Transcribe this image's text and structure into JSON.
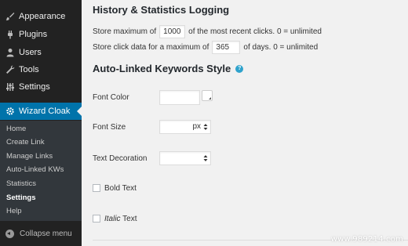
{
  "sidebar": {
    "items": [
      {
        "label": "Appearance",
        "icon": "paintbrush-icon"
      },
      {
        "label": "Plugins",
        "icon": "plug-icon"
      },
      {
        "label": "Users",
        "icon": "user-icon"
      },
      {
        "label": "Tools",
        "icon": "wrench-icon"
      },
      {
        "label": "Settings",
        "icon": "settings-sliders-icon"
      },
      {
        "label": "Wizard Cloak",
        "icon": "gear-icon",
        "active": true
      }
    ],
    "submenu": [
      "Home",
      "Create Link",
      "Manage Links",
      "Auto-Linked KWs",
      "Statistics",
      "Settings",
      "Help"
    ],
    "submenu_current": "Settings",
    "collapse_label": "Collapse menu"
  },
  "history": {
    "title": "History & Statistics Logging",
    "row1": {
      "prefix": "Store maximum of",
      "value": "1000",
      "suffix": "of the most recent clicks. 0 = unlimited"
    },
    "row2": {
      "prefix": "Store click data for a maximum of",
      "value": "365",
      "suffix": "of days. 0 = unlimited"
    }
  },
  "keywords_style": {
    "title": "Auto-Linked Keywords Style",
    "help_icon": "help-icon",
    "font_color_label": "Font Color",
    "font_size_label": "Font Size",
    "font_size_unit": "px",
    "text_decoration_label": "Text Decoration",
    "bold_label": "Bold Text",
    "italic_word": "Italic",
    "italic_rest": " Text"
  },
  "colors": {
    "sidebar_bg": "#222222",
    "submenu_bg": "#32373c",
    "active_bg": "#0073aa",
    "content_bg": "#f1f1f1"
  },
  "watermark": "www.989214.com"
}
